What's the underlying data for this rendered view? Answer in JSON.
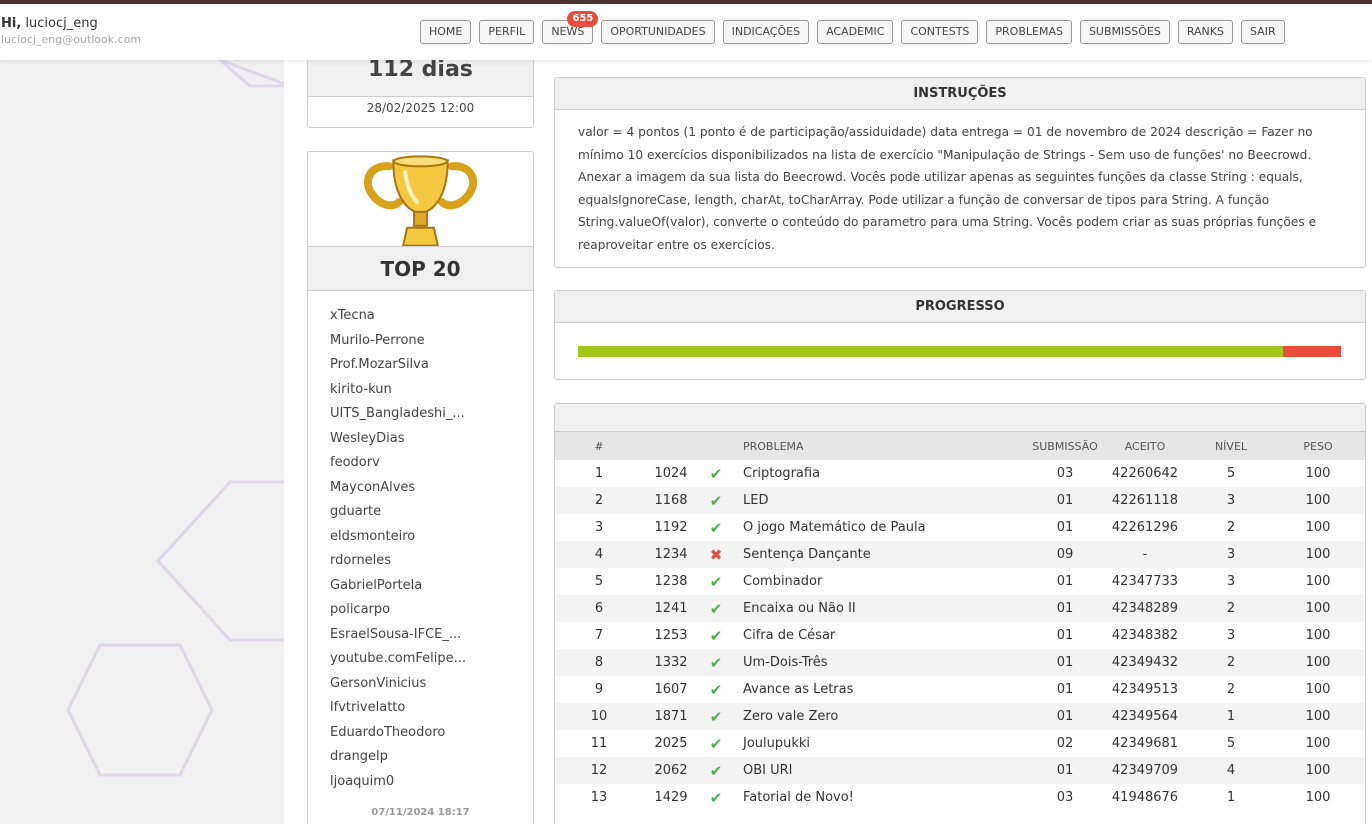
{
  "header": {
    "greeting": "Hi,",
    "username": "luciocj_eng",
    "email": "luciocj_eng@outlook.com"
  },
  "nav": [
    {
      "label": "HOME"
    },
    {
      "label": "PERFIL"
    },
    {
      "label": "NEWS",
      "badge": "655"
    },
    {
      "label": "OPORTUNIDADES"
    },
    {
      "label": "INDICAÇÕES"
    },
    {
      "label": "ACADEMIC"
    },
    {
      "label": "CONTESTS"
    },
    {
      "label": "PROBLEMAS"
    },
    {
      "label": "SUBMISSÕES"
    },
    {
      "label": "RANKS"
    },
    {
      "label": "SAIR"
    }
  ],
  "deadline": {
    "remaining": "112 dias",
    "date": "28/02/2025 12:00"
  },
  "top20": {
    "title": "TOP 20",
    "users": [
      "xTecna",
      "Murilo-Perrone",
      "Prof.MozarSilva",
      "kirito-kun",
      "UITS_Bangladeshi_...",
      "WesleyDias",
      "feodorv",
      "MayconAlves",
      "gduarte",
      "eldsmonteiro",
      "rdorneles",
      "GabrielPortela",
      "policarpo",
      "EsraelSousa-IFCE_...",
      "youtube.comFelipe...",
      "GersonVinicius",
      "lfvtrivelatto",
      "EduardoTheodoro",
      "drangelp",
      "ljoaquim0"
    ],
    "updated": "07/11/2024 18:17"
  },
  "instructions": {
    "title": "INSTRUÇÕES",
    "text": "valor = 4 pontos (1 ponto é de participação/assiduidade) data entrega = 01 de novembro de 2024 descrição = Fazer no mínimo 10 exercícios disponibilizados na lista de exercício \"Manipulação de Strings - Sem uso de funções' no Beecrowd. Anexar a imagem da sua lista do Beecrowd. Vocês pode utilizar apenas as seguintes funções da classe String : equals, equalsIgnoreCase, length, charAt, toCharArray. Pode utilizar a função de conversar de tipos para String. A função String.valueOf(valor), converte o conteúdo do parametro para uma String. Vocês podem criar as suas próprias funções e reaproveitar entre os exercícios."
  },
  "progress": {
    "title": "PROGRESSO",
    "accepted_fraction": 0.922,
    "failed_fraction": 0.076,
    "colors": {
      "accepted": "#a5c51b",
      "failed": "#e74c3c"
    }
  },
  "problems": {
    "columns": {
      "num": "#",
      "problem": "PROBLEMA",
      "submission": "SUBMISSÃO",
      "accepted": "ACEITO",
      "level": "NÍVEL",
      "weight": "PESO"
    },
    "rows": [
      {
        "n": "1",
        "id": "1024",
        "status": "ok",
        "name": "Criptografia",
        "sub": "03",
        "acc": "42260642",
        "lvl": "5",
        "peso": "100"
      },
      {
        "n": "2",
        "id": "1168",
        "status": "ok",
        "name": "LED",
        "sub": "01",
        "acc": "42261118",
        "lvl": "3",
        "peso": "100"
      },
      {
        "n": "3",
        "id": "1192",
        "status": "ok",
        "name": "O jogo Matemático de Paula",
        "sub": "01",
        "acc": "42261296",
        "lvl": "2",
        "peso": "100"
      },
      {
        "n": "4",
        "id": "1234",
        "status": "fail",
        "name": "Sentença Dançante",
        "sub": "09",
        "acc": "-",
        "lvl": "3",
        "peso": "100"
      },
      {
        "n": "5",
        "id": "1238",
        "status": "ok",
        "name": "Combinador",
        "sub": "01",
        "acc": "42347733",
        "lvl": "3",
        "peso": "100"
      },
      {
        "n": "6",
        "id": "1241",
        "status": "ok",
        "name": "Encaixa ou Não II",
        "sub": "01",
        "acc": "42348289",
        "lvl": "2",
        "peso": "100"
      },
      {
        "n": "7",
        "id": "1253",
        "status": "ok",
        "name": "Cifra de César",
        "sub": "01",
        "acc": "42348382",
        "lvl": "3",
        "peso": "100"
      },
      {
        "n": "8",
        "id": "1332",
        "status": "ok",
        "name": "Um-Dois-Três",
        "sub": "01",
        "acc": "42349432",
        "lvl": "2",
        "peso": "100"
      },
      {
        "n": "9",
        "id": "1607",
        "status": "ok",
        "name": "Avance as Letras",
        "sub": "01",
        "acc": "42349513",
        "lvl": "2",
        "peso": "100"
      },
      {
        "n": "10",
        "id": "1871",
        "status": "ok",
        "name": "Zero vale Zero",
        "sub": "01",
        "acc": "42349564",
        "lvl": "1",
        "peso": "100"
      },
      {
        "n": "11",
        "id": "2025",
        "status": "ok",
        "name": "Joulupukki",
        "sub": "02",
        "acc": "42349681",
        "lvl": "5",
        "peso": "100"
      },
      {
        "n": "12",
        "id": "2062",
        "status": "ok",
        "name": "OBI URI",
        "sub": "01",
        "acc": "42349709",
        "lvl": "4",
        "peso": "100"
      },
      {
        "n": "13",
        "id": "1429",
        "status": "ok",
        "name": "Fatorial de Novo!",
        "sub": "03",
        "acc": "41948676",
        "lvl": "1",
        "peso": "100"
      }
    ],
    "icons": {
      "ok": "check-icon",
      "fail": "cross-icon"
    }
  }
}
